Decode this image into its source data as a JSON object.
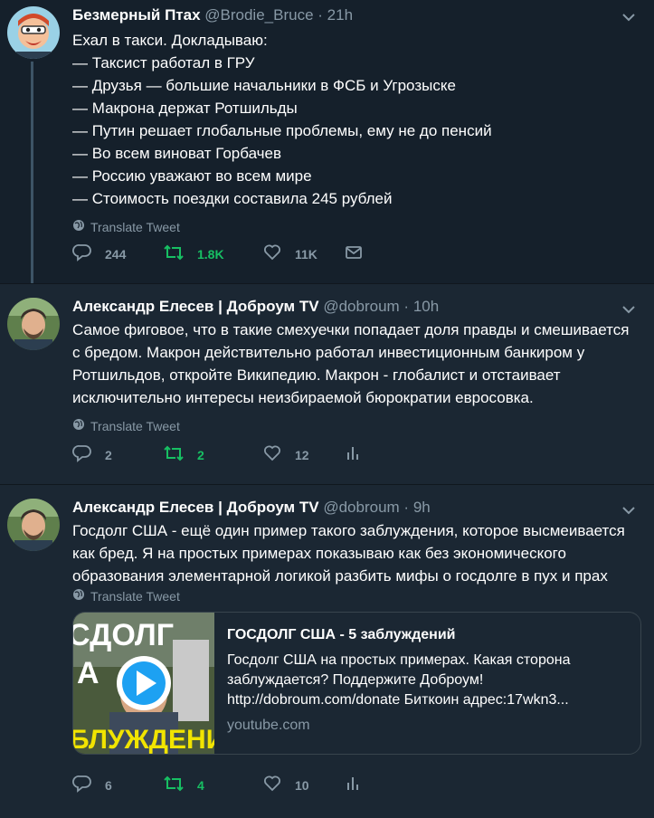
{
  "tweets": [
    {
      "name": "Безмерный Птах",
      "handle": "@Brodie_Bruce",
      "separator": "·",
      "time": "21h",
      "lines": [
        "Ехал в такси. Докладываю:",
        "— Таксист работал в ГРУ",
        "— Друзья — большие начальники в ФСБ и Угрозыске",
        "— Макрона держат Ротшильды",
        "— Путин решает глобальные проблемы, ему не до пенсий",
        "— Во всем виноват Горбачев",
        "— Россию уважают во всем мире",
        "— Стоимость поездки составила 245 рублей"
      ],
      "translate": "Translate Tweet",
      "replies": "244",
      "retweets": "1.8K",
      "likes": "11K",
      "icons": [
        "reply-icon",
        "retweet-icon",
        "like-icon",
        "message-icon"
      ]
    },
    {
      "name": "Александр Елесев | Доброум TV",
      "handle": "@dobroum",
      "separator": "·",
      "time": "10h",
      "lines": [
        "Самое фиговое, что в такие смехуечки попадает доля правды и смешивается",
        "с бредом. Макрон действительно работал инвестиционным банкиром у",
        "Ротшильдов, откройте Википедию. Макрон - глобалист и отстаивает",
        "исключительно интересы неизбираемой бюрократии евросовка."
      ],
      "translate": "Translate Tweet",
      "replies": "2",
      "retweets": "2",
      "likes": "12",
      "icons": [
        "reply-icon",
        "retweet-icon",
        "like-icon",
        "analytics-icon"
      ]
    },
    {
      "name": "Александр Елесев | Доброум TV",
      "handle": "@dobroum",
      "separator": "·",
      "time": "9h",
      "lines": [
        "Госдолг США - ещё один пример такого заблуждения, которое высмеивается",
        "как бред. Я на простых примерах показываю как без экономического",
        "образования элементарной логикой разбить мифы о госдолге в пух и прах"
      ],
      "translate": "Translate Tweet",
      "replies": "6",
      "retweets": "4",
      "likes": "10",
      "icons": [
        "reply-icon",
        "retweet-icon",
        "like-icon",
        "analytics-icon"
      ],
      "card": {
        "title": "ГОСДОЛГ США - 5 заблуждений",
        "desc_lines": [
          "Госдолг США на простых примерах. Какая сторона",
          "заблуждается? Поддержите Доброум!",
          "http://dobroum.com/donate Биткоин адрес:17wkn3..."
        ],
        "domain": "youtube.com",
        "thumb_text_top": "СДОЛГ",
        "thumb_text_mid": "А",
        "thumb_text_bottom": "БЛУЖДЕНИЙ"
      }
    }
  ],
  "colors": {
    "background": "#15202b",
    "reply_background": "#1b2733",
    "muted": "#8899a6",
    "retweet_green": "#17bf63",
    "thread_line": "#3d5466"
  }
}
